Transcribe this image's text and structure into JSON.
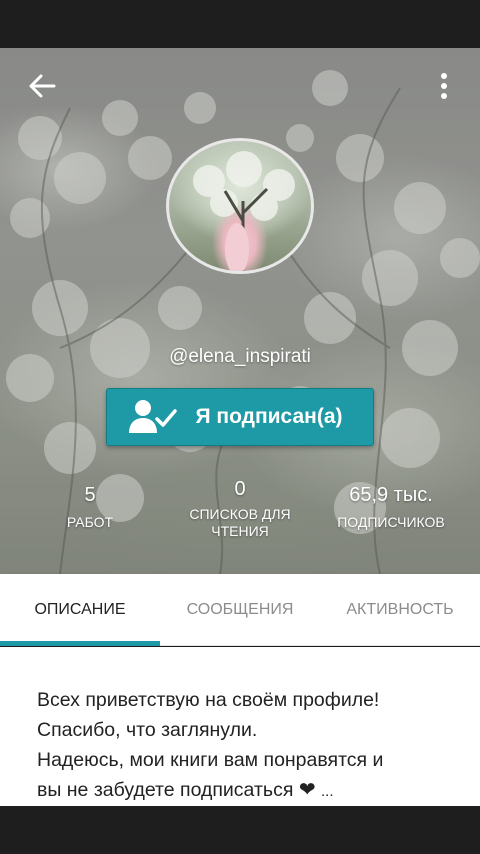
{
  "profile": {
    "username": "@elena_inspirati",
    "follow_button_label": "Я подписан(а)"
  },
  "stats": [
    {
      "value": "5",
      "label": "РАБОТ"
    },
    {
      "value": "0",
      "label_line1": "СПИСКОВ ДЛЯ",
      "label_line2": "ЧТЕНИЯ"
    },
    {
      "value": "65,9 тыс.",
      "label": "ПОДПИСЧИКОВ"
    }
  ],
  "tabs": [
    {
      "label": "ОПИСАНИЕ",
      "active": true
    },
    {
      "label": "СООБЩЕНИЯ",
      "active": false
    },
    {
      "label": "АКТИВНОСТЬ",
      "active": false
    }
  ],
  "description": {
    "line1": "Всех приветствую на своём профиле!",
    "line2": "Спасибо, что заглянули.",
    "line3": "Надеюсь, мои книги вам понравятся и",
    "line4_text": "вы не забудете подписаться",
    "heart": "❤",
    "ellipsis": "..."
  },
  "icons": {
    "back": "arrow-left-icon",
    "menu": "more-vertical-icon",
    "follow": "user-check-icon"
  },
  "colors": {
    "accent": "#1d9aa5",
    "tab_active_text": "#222222",
    "tab_inactive_text": "#8c8c8c"
  }
}
